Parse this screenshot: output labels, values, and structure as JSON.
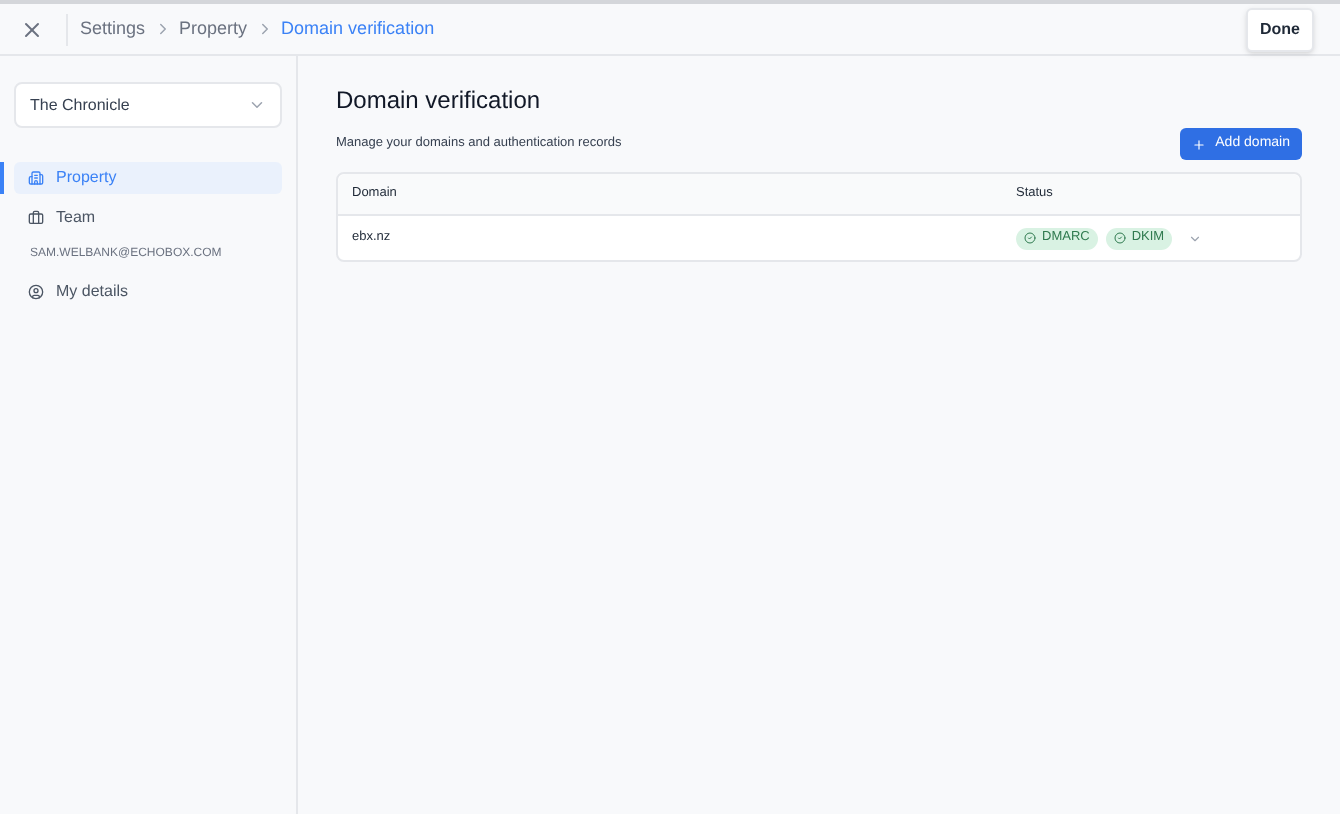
{
  "breadcrumbs": [
    {
      "label": "Settings",
      "selected": false
    },
    {
      "label": "Property",
      "selected": false
    },
    {
      "label": "Domain verification",
      "selected": true
    }
  ],
  "done_button": "Done",
  "property_select": {
    "value": "The Chronicle"
  },
  "sidebar": {
    "items": [
      {
        "kind": "link",
        "label": "Property",
        "selected": true
      },
      {
        "kind": "link",
        "label": "Team",
        "selected": false
      },
      {
        "kind": "heading",
        "label": "SAM.WELBANK@ECHOBOX.COM"
      },
      {
        "kind": "link",
        "label": "My details",
        "selected": false
      }
    ]
  },
  "page": {
    "title": "Domain verification",
    "subtitle": "Manage your domains and authentication records",
    "add_button": "Add domain"
  },
  "table": {
    "columns": [
      "Domain",
      "Status"
    ],
    "rows": [
      {
        "domain": "ebx.nz",
        "badges": [
          "DMARC",
          "DKIM"
        ]
      }
    ]
  }
}
